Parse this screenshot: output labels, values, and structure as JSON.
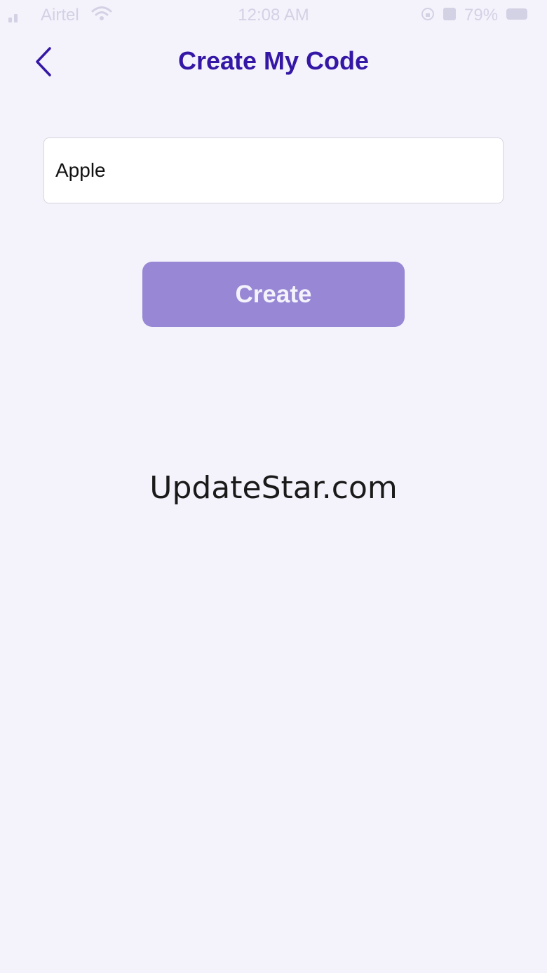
{
  "status_bar": {
    "carrier": "Airtel",
    "time": "12:08 AM",
    "battery": "79%"
  },
  "header": {
    "title": "Create My Code",
    "back_icon": "chevron-left-icon"
  },
  "form": {
    "input_value": "Apple",
    "create_label": "Create"
  },
  "watermark": {
    "text": "UpdateStar.com"
  },
  "colors": {
    "accent": "#3517a6",
    "button_bg": "#9787d4",
    "background": "#f4f3fc"
  }
}
